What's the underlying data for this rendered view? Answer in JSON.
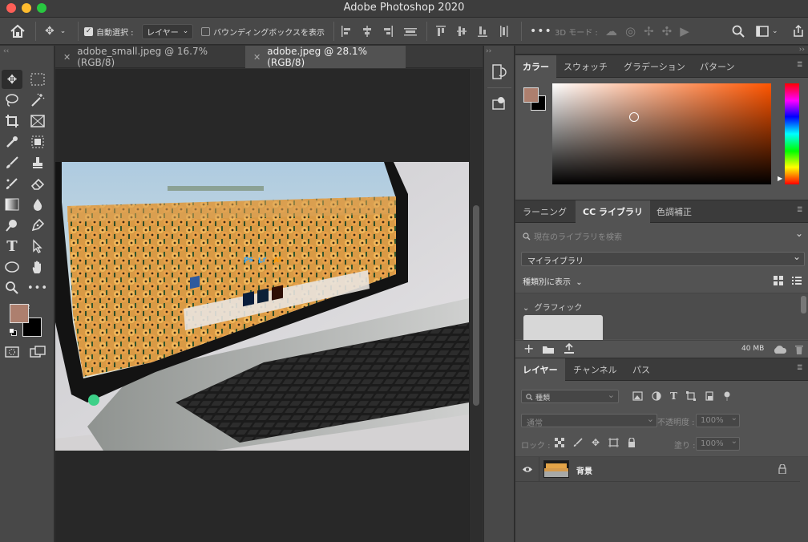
{
  "window": {
    "title": "Adobe Photoshop 2020"
  },
  "options": {
    "auto_select_label": "自動選択 :",
    "auto_select_value": "レイヤー",
    "bounding_box_label": "バウンディングボックスを表示",
    "mode_3d_label": "3D モード :"
  },
  "documents": [
    {
      "label": "adobe_small.jpeg @ 16.7% (RGB/8)"
    },
    {
      "label": "adobe.jpeg @ 28.1% (RGB/8)"
    }
  ],
  "color_panel": {
    "tabs": [
      "カラー",
      "スウォッチ",
      "グラデーション",
      "パターン"
    ],
    "foreground": "#ad7f6e",
    "background": "#000000",
    "hue": "#ff5500"
  },
  "library_panel": {
    "tabs": [
      "ラーニング",
      "CC ライブラリ",
      "色調補正"
    ],
    "search_placeholder": "現在のライブラリを検索",
    "library_select": "マイライブラリ",
    "view_by_label": "種類別に表示",
    "graphics_label": "グラフィック",
    "storage": "40 MB"
  },
  "layers_panel": {
    "tabs": [
      "レイヤー",
      "チャンネル",
      "パス"
    ],
    "filter_label": "種類",
    "blend_mode": "通常",
    "opacity_label": "不透明度 :",
    "opacity_value": "100%",
    "lock_label": "ロック :",
    "fill_label": "塗り :",
    "fill_value": "100%",
    "layers": [
      {
        "name": "背景"
      }
    ]
  }
}
